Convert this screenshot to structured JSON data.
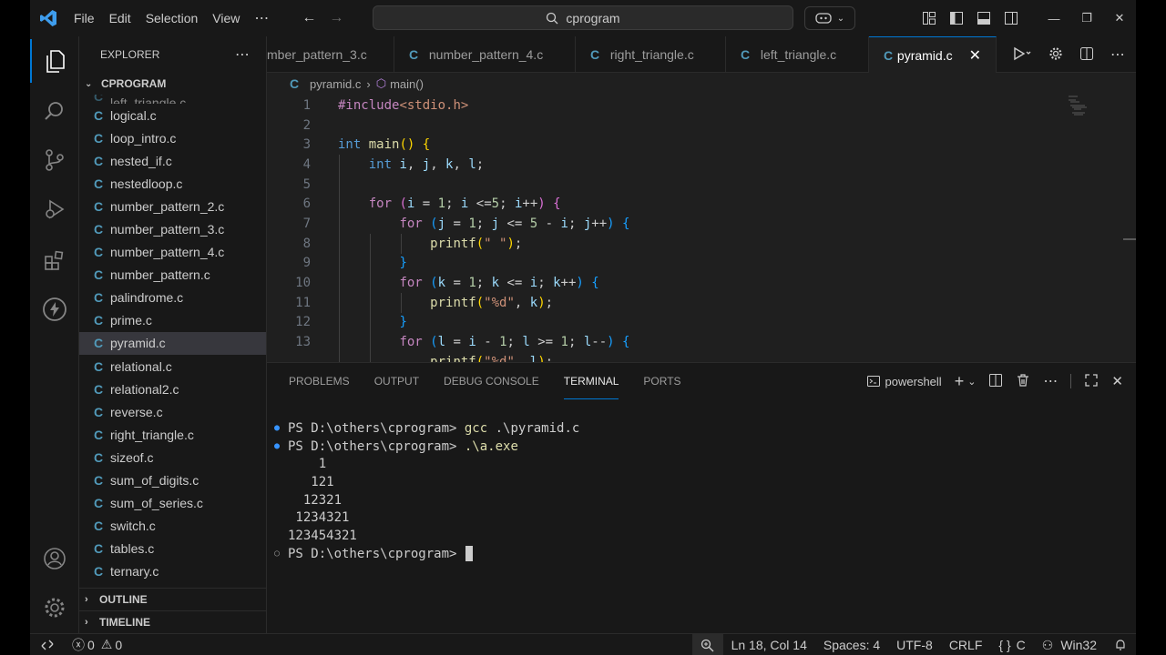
{
  "titlebar": {
    "menus": [
      "File",
      "Edit",
      "Selection",
      "View"
    ],
    "search": "cprogram"
  },
  "sidebar": {
    "title": "EXPLORER",
    "folder": "CPROGRAM",
    "partial_file": "left_triangle.c",
    "files": [
      "logical.c",
      "loop_intro.c",
      "nested_if.c",
      "nestedloop.c",
      "number_pattern_2.c",
      "number_pattern_3.c",
      "number_pattern_4.c",
      "number_pattern.c",
      "palindrome.c",
      "prime.c",
      "pyramid.c",
      "relational.c",
      "relational2.c",
      "reverse.c",
      "right_triangle.c",
      "sizeof.c",
      "sum_of_digits.c",
      "sum_of_series.c",
      "switch.c",
      "tables.c",
      "ternary.c"
    ],
    "selected": "pyramid.c",
    "outline": "OUTLINE",
    "timeline": "TIMELINE"
  },
  "tabs": [
    "mber_pattern_3.c",
    "number_pattern_4.c",
    "right_triangle.c",
    "left_triangle.c",
    "pyramid.c"
  ],
  "active_tab": "pyramid.c",
  "breadcrumb": {
    "file": "pyramid.c",
    "symbol": "main()"
  },
  "line_numbers": [
    "1",
    "2",
    "3",
    "4",
    "5",
    "6",
    "7",
    "8",
    "9",
    "10",
    "11",
    "12",
    "13"
  ],
  "panel": {
    "tabs": [
      "PROBLEMS",
      "OUTPUT",
      "DEBUG CONSOLE",
      "TERMINAL",
      "PORTS"
    ],
    "active": "TERMINAL",
    "shell": "powershell"
  },
  "terminal": {
    "prompt": "PS D:\\others\\cprogram> ",
    "cmd1": "gcc",
    "arg1": " .\\pyramid.c",
    "cmd2": ".\\a.exe",
    "output": [
      "    1",
      "   121",
      "  12321",
      " 1234321",
      "123454321"
    ]
  },
  "statusbar": {
    "errors": "0",
    "warnings": "0",
    "position": "Ln 18, Col 14",
    "spaces": "Spaces: 4",
    "encoding": "UTF-8",
    "eol": "CRLF",
    "language": "C",
    "platform": "Win32"
  },
  "colors": {
    "accent": "#0078d4",
    "c_icon": "#519aba"
  }
}
